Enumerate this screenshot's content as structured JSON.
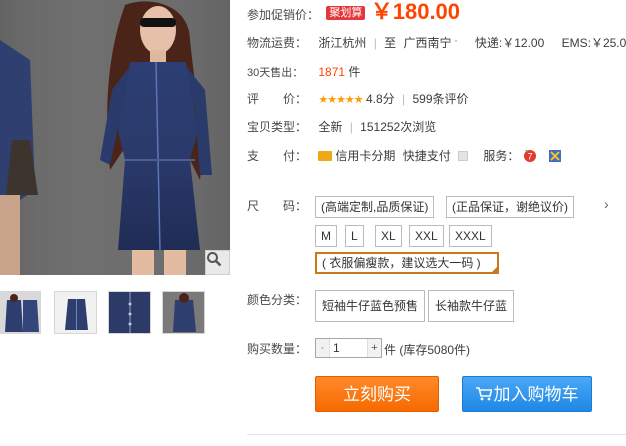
{
  "promotion": {
    "label": "促销价：",
    "label_prefix": "参加",
    "tag": "聚划算",
    "currency": "￥",
    "price": "180.00"
  },
  "shipping": {
    "label": "物流运费：",
    "from": "浙江杭州",
    "to_prefix": "至",
    "to": "广西南宁",
    "express": "快递:￥12.00",
    "ems": "EMS:￥25.0"
  },
  "sales": {
    "label": "30天售出：",
    "count": "1871",
    "unit": "件"
  },
  "rating": {
    "label": "评　　价：",
    "stars": "★★★★★",
    "score": "4.8分",
    "reviews": "599条评价"
  },
  "item_type": {
    "label": "宝贝类型：",
    "condition": "全新",
    "views": "151252次浏览"
  },
  "payment": {
    "label": "支　　付：",
    "credit": "信用卡分期",
    "quick": "快捷支付",
    "service_label": "服务："
  },
  "size": {
    "label": "尺　　码：",
    "notes": [
      "(高端定制,品质保证)",
      "(正品保证，谢绝议价)"
    ],
    "more": "›",
    "options": [
      "M",
      "L",
      "XL",
      "XXL",
      "XXXL"
    ],
    "selected_tip": "( 衣服偏瘦款，建议选大一码 )"
  },
  "colors": {
    "label": "颜色分类：",
    "options": [
      "短袖牛仔蓝色预售",
      "长袖款牛仔蓝"
    ]
  },
  "quantity": {
    "label": "购买数量：",
    "minus": "-",
    "plus": "+",
    "value": "1",
    "unit": "件",
    "stock": "(库存5080件)"
  },
  "actions": {
    "buy": "立刻购买",
    "cart": "加入购物车"
  },
  "icons": {
    "zoom": "magnifier-icon",
    "credit": "card-icon",
    "service1": "badge-icon",
    "service2": "shield-icon",
    "cart": "cart-icon"
  },
  "colors_theme": {
    "price": "#ff4400",
    "buy": "#f66a00",
    "cart": "#1e88e5",
    "selected_border": "#c87a1b"
  }
}
